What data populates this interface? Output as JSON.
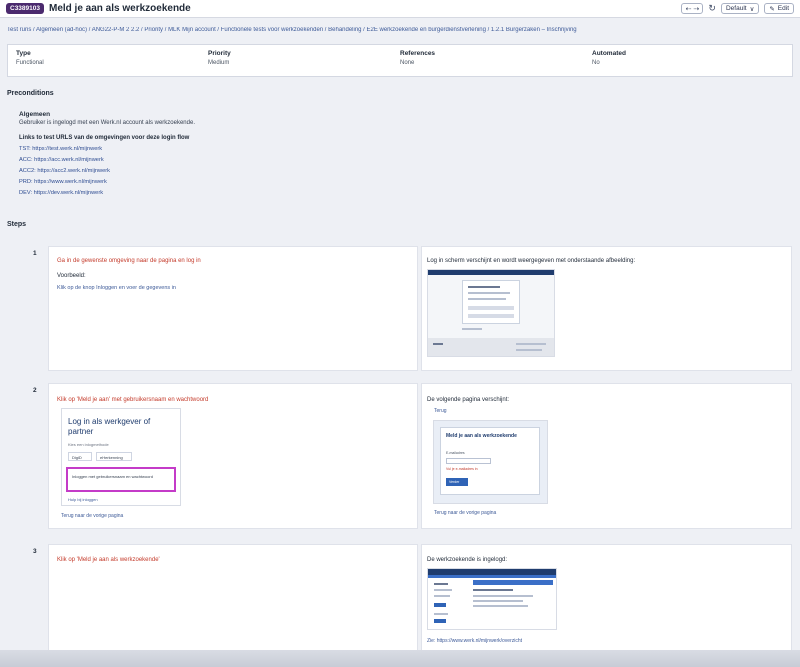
{
  "header": {
    "case_id": "C3389103",
    "title": "Meld je aan als werkzoekende",
    "nav_label": "⟨ ⟩",
    "refresh_icon": "refresh-icon",
    "select_label": "Default",
    "edit_label": "Edit"
  },
  "breadcrumb": "Test runs / Algemeen (ad-hoc) / ANG22-P-M 2 2.2 / Priority / MLK Mijn account / Functionele tests voor werkzoekenden / Behandeling / E2E werkzoekende en burgerdienstverlening / 1.2.1 Burgerzaken – Inschrijving",
  "meta": [
    {
      "label": "Type",
      "value": "Functional"
    },
    {
      "label": "Priority",
      "value": "Medium"
    },
    {
      "label": "References",
      "value": "None"
    },
    {
      "label": "Automated",
      "value": "No"
    }
  ],
  "preconditions": {
    "heading": "Preconditions",
    "sub_heading": "Algemeen",
    "text": "Gebruiker is ingelogd met een Werk.nl account als werkzoekende.",
    "links_heading": "Links to test URLS van de omgevingen voor deze login flow",
    "links": [
      "TST: https://test.werk.nl/mijnwerk",
      "ACC: https://acc.werk.nl/mijnwerk",
      "ACC2: https://acc2.werk.nl/mijnwerk",
      "PRD: https://www.werk.nl/mijnwerk",
      "DEV: https://dev.werk.nl/mijnwerk"
    ]
  },
  "steps_heading": "Steps",
  "steps": [
    {
      "number": "1",
      "action": "Ga in de gewenste omgeving naar de pagina en log in",
      "action_sub1": "Voorbeeld:",
      "action_sub2": "Klik op de knop Inloggen en voer de gegevens in",
      "expected": "Log in scherm verschijnt en wordt weergegeven met onderstaande afbeelding:"
    },
    {
      "number": "2",
      "action": "Klik op 'Meld je aan' met gebruikersnaam en wachtwoord",
      "login_title_1": "Log in als werkgever of",
      "login_title_2": "partner",
      "login_sub": "Kies een inlogmethode",
      "option_1": "DigiD",
      "option_2": "eHerkenning",
      "highlighted": "Inloggen met gebruikersnaam en wachtwoord",
      "link_below": "Hulp bij inloggen",
      "link_under_card": "Terug naar de vorige pagina",
      "expected": "De volgende pagina verschijnt:",
      "exp_link_top": "Terug",
      "exp_box_title": "Meld je aan als werkzoekende",
      "exp_field_label": "E-mailadres",
      "exp_error": "Vul je e-mailadres in",
      "exp_button": "Verder",
      "exp_link_below": "Terug naar de vorige pagina"
    },
    {
      "number": "3",
      "action": "Klik op 'Meld je aan als werkzoekende'",
      "expected": "De werkzoekende is ingelogd:",
      "exp_url": "Zie: https://www.werk.nl/mijnwerk/overzicht"
    }
  ]
}
